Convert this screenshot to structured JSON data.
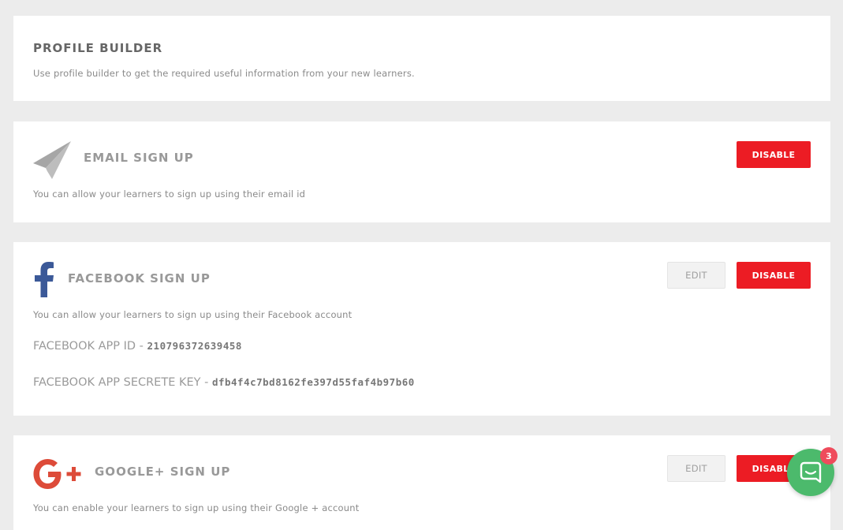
{
  "profile_builder": {
    "title": "PROFILE BUILDER",
    "description": "Use profile builder to get the required useful information from your new learners."
  },
  "email_signup": {
    "icon": "paper-plane-icon",
    "title": "EMAIL SIGN UP",
    "description": "You can allow your learners to sign up using their email id",
    "disable_label": "DISABLE"
  },
  "facebook_signup": {
    "icon": "facebook-icon",
    "title": "FACEBOOK SIGN UP",
    "description": "You can allow your learners to sign up using their Facebook account",
    "edit_label": "EDIT",
    "disable_label": "DISABLE",
    "app_id_label": "FACEBOOK APP ID - ",
    "app_id_value": "210796372639458",
    "secret_label": "FACEBOOK APP SECRETE KEY - ",
    "secret_value": "dfb4f4c7bd8162fe397d55faf4b97b60"
  },
  "google_signup": {
    "icon": "google-plus-icon",
    "title": "GOOGLE+ SIGN UP",
    "description": "You can enable your learners to sign up using their Google + account",
    "edit_label": "EDIT",
    "disable_label": "DISABLE"
  },
  "chat_widget": {
    "icon": "chat-icon",
    "badge_count": "3"
  },
  "colors": {
    "disable_button": "#ec1c24",
    "facebook_blue": "#3b5998",
    "google_red": "#dd4b39",
    "chat_green": "#4cba6c",
    "badge_red": "#ef4b5c",
    "page_background": "#ececec"
  }
}
